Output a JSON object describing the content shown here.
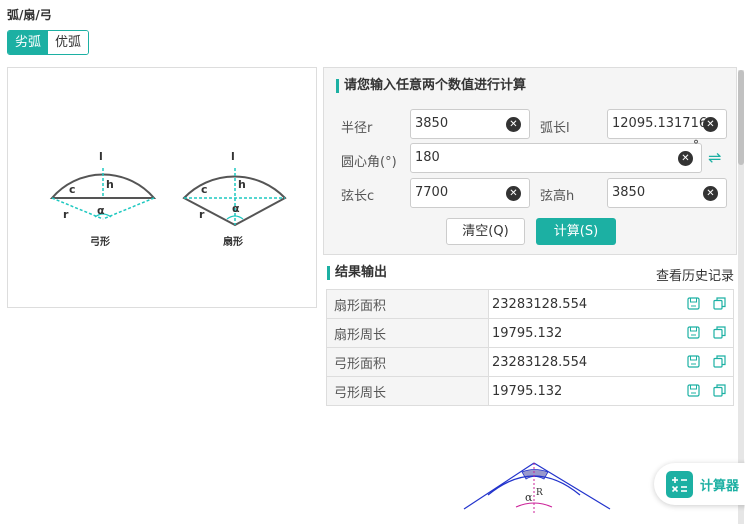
{
  "title": "弧/扇/弓",
  "tabs": [
    {
      "label": "劣弧",
      "active": true
    },
    {
      "label": "优弧",
      "active": false
    }
  ],
  "diagram": {
    "label_l": "l",
    "label_h": "h",
    "label_c": "c",
    "label_r": "r",
    "label_alpha": "α",
    "bow_caption": "弓形",
    "sector_caption": "扇形"
  },
  "calc": {
    "title": "请您输入任意两个数值进行计算",
    "radius_label": "半径r",
    "radius_value": "3850",
    "arc_label": "弧长l",
    "arc_value": "12095.131716",
    "angle_label": "圆心角(°)",
    "angle_value": "180",
    "angle_unit": "°",
    "chord_label": "弦长c",
    "chord_value": "7700",
    "height_label": "弦高h",
    "height_value": "3850",
    "clear_button": "清空(Q)",
    "calc_button": "计算(S)"
  },
  "results": {
    "title": "结果输出",
    "history_link": "查看历史记录",
    "rows": [
      {
        "key": "扇形面积",
        "value": "23283128.554"
      },
      {
        "key": "扇形周长",
        "value": "19795.132"
      },
      {
        "key": "弓形面积",
        "value": "23283128.554"
      },
      {
        "key": "弓形周长",
        "value": "19795.132"
      }
    ]
  },
  "bottom_diagram": {
    "label_r": "R",
    "label_alpha": "α"
  },
  "widget": {
    "label": "计算器"
  },
  "colors": {
    "accent": "#1cb0a3",
    "dashed": "#1ec8c0",
    "shape_stroke": "#555555"
  }
}
